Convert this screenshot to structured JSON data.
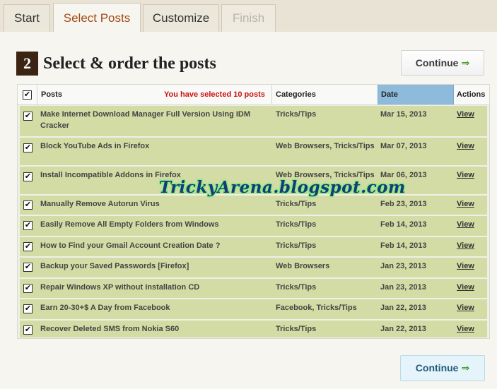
{
  "tabs": [
    {
      "label": "Start"
    },
    {
      "label": "Select Posts"
    },
    {
      "label": "Customize"
    },
    {
      "label": "Finish"
    }
  ],
  "step": {
    "number": "2",
    "title": "Select & order the posts"
  },
  "buttons": {
    "continue_label": "Continue",
    "continue_arrow": "⇒"
  },
  "table": {
    "headers": {
      "posts": "Posts",
      "selected_note": "You have selected 10 posts",
      "categories": "Categories",
      "date": "Date",
      "actions": "Actions"
    },
    "check_glyph": "✔",
    "rows": [
      {
        "title": "Make Internet Download Manager Full Version Using IDM Cracker",
        "category": "Tricks/Tips",
        "date": "Mar 15, 2013",
        "action": "View"
      },
      {
        "title": "Block YouTube Ads in Firefox",
        "category": "Web Browsers, Tricks/Tips",
        "date": "Mar 07, 2013",
        "action": "View"
      },
      {
        "title": "Install Incompatible Addons in Firefox",
        "category": "Web Browsers, Tricks/Tips",
        "date": "Mar 06, 2013",
        "action": "View"
      },
      {
        "title": "Manually Remove Autorun Virus",
        "category": "Tricks/Tips",
        "date": "Feb 23, 2013",
        "action": "View"
      },
      {
        "title": "Easily Remove All Empty Folders from Windows",
        "category": "Tricks/Tips",
        "date": "Feb 14, 2013",
        "action": "View"
      },
      {
        "title": "How to Find your Gmail Account Creation Date ?",
        "category": "Tricks/Tips",
        "date": "Feb 14, 2013",
        "action": "View"
      },
      {
        "title": "Backup your Saved Passwords [Firefox]",
        "category": "Web Browsers",
        "date": "Jan 23, 2013",
        "action": "View"
      },
      {
        "title": "Repair Windows XP without Installation CD",
        "category": "Tricks/Tips",
        "date": "Jan 23, 2013",
        "action": "View"
      },
      {
        "title": "Earn 20-30+$ A Day from Facebook",
        "category": "Facebook, Tricks/Tips",
        "date": "Jan 22, 2013",
        "action": "View"
      },
      {
        "title": "Recover Deleted SMS from Nokia S60",
        "category": "Tricks/Tips",
        "date": "Jan 22, 2013",
        "action": "View"
      }
    ]
  },
  "watermark": "TrickyArena.blogspot.com"
}
